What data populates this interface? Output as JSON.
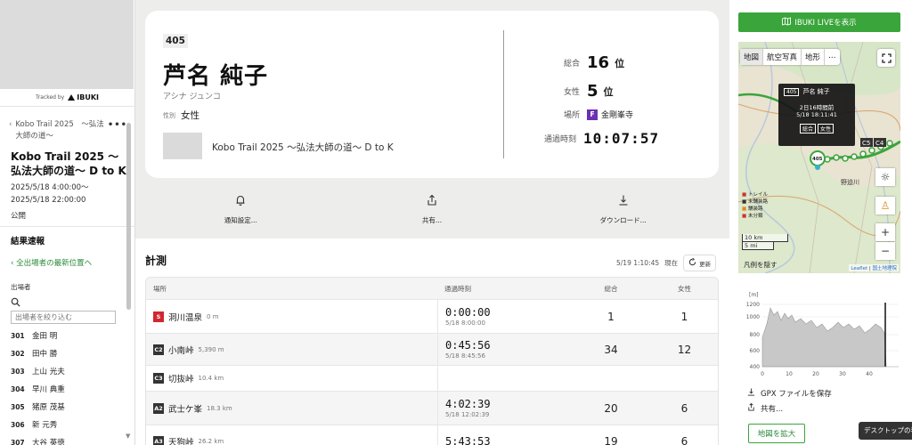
{
  "sidebar": {
    "tracked_by": "Tracked by",
    "brand": "IBUKI",
    "event_short": "Kobo Trail 2025　～弘法大師の道～",
    "event_title": "Kobo Trail 2025 ～弘法大師の道～ D to K",
    "date_start": "2025/5/18 4:00:00～",
    "date_end": "2025/5/18 22:00:00",
    "visibility": "公開",
    "results_heading": "結果速報",
    "latest_link": "全出場者の最新位置へ",
    "participants_label": "出場者",
    "filter_placeholder": "出場者を絞り込む",
    "runners": [
      {
        "bib": "301",
        "name": "金田 明"
      },
      {
        "bib": "302",
        "name": "田中 勝"
      },
      {
        "bib": "303",
        "name": "上山 光夫"
      },
      {
        "bib": "304",
        "name": "早川 典重"
      },
      {
        "bib": "305",
        "name": "猪原 茂基"
      },
      {
        "bib": "306",
        "name": "新 元秀"
      },
      {
        "bib": "307",
        "name": "大谷 英徳"
      }
    ]
  },
  "runner": {
    "bib": "405",
    "name": "芦名 純子",
    "kana": "アシナ ジュンコ",
    "gender_label": "性別",
    "gender": "女性",
    "event_name": "Kobo Trail 2025 ～弘法大師の道～ D to K"
  },
  "stats": {
    "overall_label": "総合",
    "overall_rank": "16",
    "gender_label": "女性",
    "gender_rank": "5",
    "rank_unit": "位",
    "location_label": "場所",
    "location_code": "F",
    "location_name": "金剛峯寺",
    "passing_label": "通過時刻",
    "passing_time": "10:07:57"
  },
  "actions": {
    "notify": "通知設定...",
    "share": "共有...",
    "download": "ダウンロード..."
  },
  "results": {
    "title": "計測",
    "updated": "5/19 1:10:45",
    "current": "現在",
    "refresh": "更新",
    "headers": {
      "place": "場所",
      "time": "通過時刻",
      "overall": "総合",
      "female": "女性"
    },
    "rows": [
      {
        "code": "S",
        "name": "洞川温泉",
        "dist": "0 m",
        "time": "0:00:00",
        "clock": "5/18 8:00:00",
        "overall": "1",
        "female": "1"
      },
      {
        "code": "C2",
        "name": "小南峠",
        "dist": "5,390 m",
        "time": "0:45:56",
        "clock": "5/18 8:45:56",
        "overall": "34",
        "female": "12"
      },
      {
        "code": "C3",
        "name": "切抜峠",
        "dist": "10.4 km",
        "time": "",
        "clock": "",
        "overall": "",
        "female": ""
      },
      {
        "code": "A2",
        "name": "武士ケ峯",
        "dist": "18.3 km",
        "time": "4:02:39",
        "clock": "5/18 12:02:39",
        "overall": "20",
        "female": "6"
      },
      {
        "code": "A3",
        "name": "天狗峠",
        "dist": "26.2 km",
        "time": "5:43:53",
        "clock": "",
        "overall": "19",
        "female": "6"
      }
    ]
  },
  "right": {
    "live_button": "IBUKI LIVEを表示",
    "map_tabs": [
      "地図",
      "航空写真",
      "地形",
      "…"
    ],
    "popup": {
      "bib": "405",
      "name": "芦名 純子",
      "relative": "2日16時間前",
      "absolute": "5/18 18:11:41",
      "tags": [
        "総合",
        "女性"
      ]
    },
    "marker_label": "405",
    "checkpoint_labels": [
      "C5",
      "C4"
    ],
    "place_label": "野迫川",
    "legend": [
      "トレイル",
      "未舗装路",
      "舗装路",
      "未分類"
    ],
    "scale_km": "10 km",
    "scale_mi": "5 mi",
    "legend_hide": "凡例を隠す",
    "attribution_leaflet": "Leaflet",
    "attribution_gsi": "国土地理院",
    "elevation": {
      "y_unit": "[m]",
      "y_ticks": [
        "1200",
        "1000",
        "800",
        "600",
        "400"
      ],
      "x_ticks": [
        "0",
        "10",
        "20",
        "30",
        "40"
      ]
    },
    "gpx": "GPX ファイルを保存",
    "share": "共有...",
    "expand": "地図を拡大"
  },
  "tooltip": "デスクトップの表示"
}
